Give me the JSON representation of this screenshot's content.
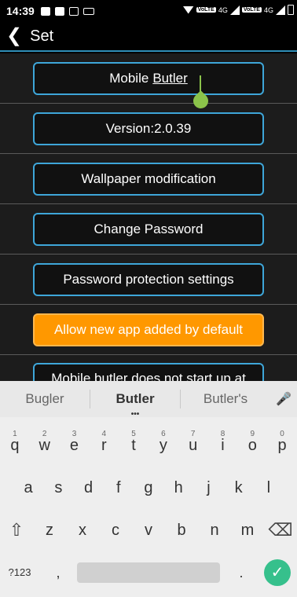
{
  "status": {
    "time": "14:39",
    "volte1": "VoLTE",
    "net1": "4G",
    "volte2": "VoLTE",
    "net2": "4G"
  },
  "appbar": {
    "title": "Set"
  },
  "settings": {
    "mobile_butler_prefix": "Mobile",
    "mobile_butler_editing": "Butler",
    "version": "Version:2.0.39",
    "wallpaper": "Wallpaper modification",
    "change_password": "Change Password",
    "password_protection": "Password protection settings",
    "allow_new_app": "Allow new app added by default",
    "startup_partial": "Mobile butler does not start up at"
  },
  "suggestions": [
    "Bugler",
    "Butler",
    "Butler's"
  ],
  "keyboard": {
    "row1": [
      "q",
      "w",
      "e",
      "r",
      "t",
      "y",
      "u",
      "i",
      "o",
      "p"
    ],
    "row1_numbers": [
      "1",
      "2",
      "3",
      "4",
      "5",
      "6",
      "7",
      "8",
      "9",
      "0"
    ],
    "row2": [
      "a",
      "s",
      "d",
      "f",
      "g",
      "h",
      "j",
      "k",
      "l"
    ],
    "row3": [
      "z",
      "x",
      "c",
      "v",
      "b",
      "n",
      "m"
    ],
    "symbols": "?123",
    "comma": ",",
    "period": "."
  },
  "colors": {
    "accent": "#3ea6d9",
    "orange_button": "#ff9800",
    "cursor": "#8bc34a",
    "done_button": "#36c08c"
  }
}
